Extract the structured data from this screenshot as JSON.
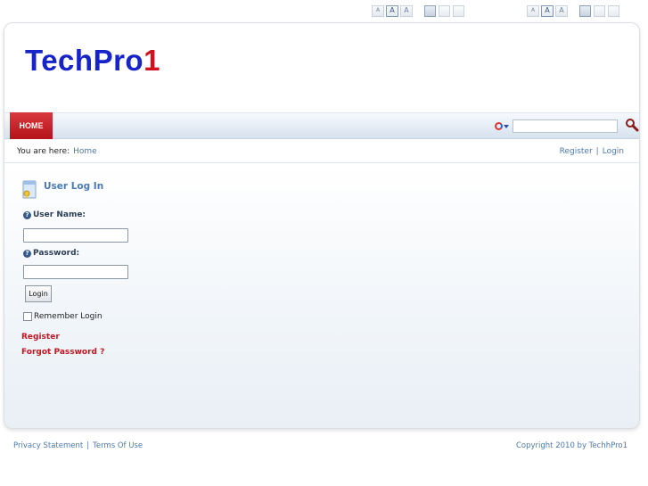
{
  "top_toolbar": {
    "font_small": "A",
    "font_medium": "A",
    "font_large": "A"
  },
  "header": {
    "logo_main": "TechPro",
    "logo_accent": "1",
    "logo_main_color": "#1523c9",
    "logo_accent_color": "#d4101e"
  },
  "nav": {
    "home_label": "HOME"
  },
  "search": {
    "value": "",
    "engine_icon": "search-engine-icon"
  },
  "breadcrumb": {
    "prefix": "You are here:",
    "home": "Home"
  },
  "account_links": {
    "register": "Register",
    "separator": "|",
    "login": "Login"
  },
  "login_module": {
    "title": "User Log In",
    "username_label": "User Name:",
    "username_value": "",
    "password_label": "Password:",
    "password_value": "",
    "login_button": "Login",
    "remember_label": "Remember Login",
    "register_link": "Register",
    "forgot_link": "Forgot Password ?"
  },
  "footer": {
    "privacy": "Privacy Statement",
    "separator": "|",
    "terms": "Terms Of Use",
    "copyright": "Copyright 2010 by TechhPro1"
  },
  "colors": {
    "nav_active": "#c41521",
    "link": "#4d79ae",
    "link_red": "#c41521"
  }
}
